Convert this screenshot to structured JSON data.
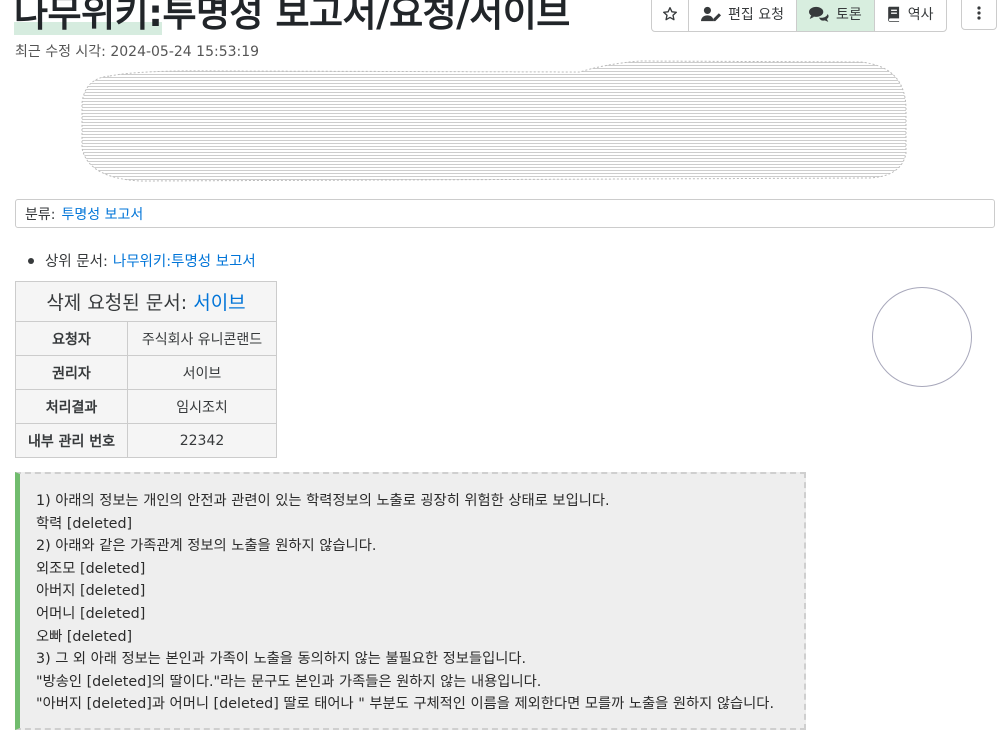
{
  "page": {
    "title_ns": "나무위키:",
    "title_rest": "투명성 보고서/요청/서이브",
    "last_modified": "최근 수정 시각: 2024-05-24 15:53:19"
  },
  "toolbar": {
    "star_icon": "star-icon",
    "edit_request_label": "편집 요청",
    "discussion_label": "토론",
    "history_label": "역사",
    "more_icon": "vertical-ellipsis-icon"
  },
  "category": {
    "label": "분류:",
    "link": "투명성 보고서"
  },
  "parent": {
    "label": "상위 문서:",
    "link": "나무위키:투명성 보고서"
  },
  "request_table": {
    "heading": "삭제 요청된 문서:",
    "heading_link": "서이브",
    "rows": [
      {
        "key": "요청자",
        "value": "주식회사 유니콘랜드"
      },
      {
        "key": "권리자",
        "value": "서이브"
      },
      {
        "key": "처리결과",
        "value": "임시조치"
      },
      {
        "key": "내부 관리 번호",
        "value": "22342"
      }
    ]
  },
  "notice": {
    "lines": [
      "1) 아래의 정보는 개인의 안전과 관련이 있는 학력정보의 노출로 굉장히 위험한 상태로 보입니다.",
      "학력 [deleted]",
      "2) 아래와 같은 가족관계 정보의 노출을 원하지 않습니다.",
      "외조모 [deleted]",
      "아버지 [deleted]",
      "어머니 [deleted]",
      "오빠 [deleted]",
      "3) 그 외 아래 정보는 본인과 가족이 노출을 동의하지 않는 불필요한 정보들입니다.",
      "\"방송인 [deleted]의 딸이다.\"라는 문구도 본인과 가족들은 원하지 않는 내용입니다.",
      "\"아버지 [deleted]과 어머니 [deleted] 딸로 태어나 \" 부분도 구체적인 이름을 제외한다면 모를까 노출을 원하지 않습니다."
    ]
  },
  "colors": {
    "link": "#0275d8",
    "discussion_bg": "#d8eedf",
    "notice_border": "#71bc6e",
    "notice_bg": "#eeeeee"
  }
}
